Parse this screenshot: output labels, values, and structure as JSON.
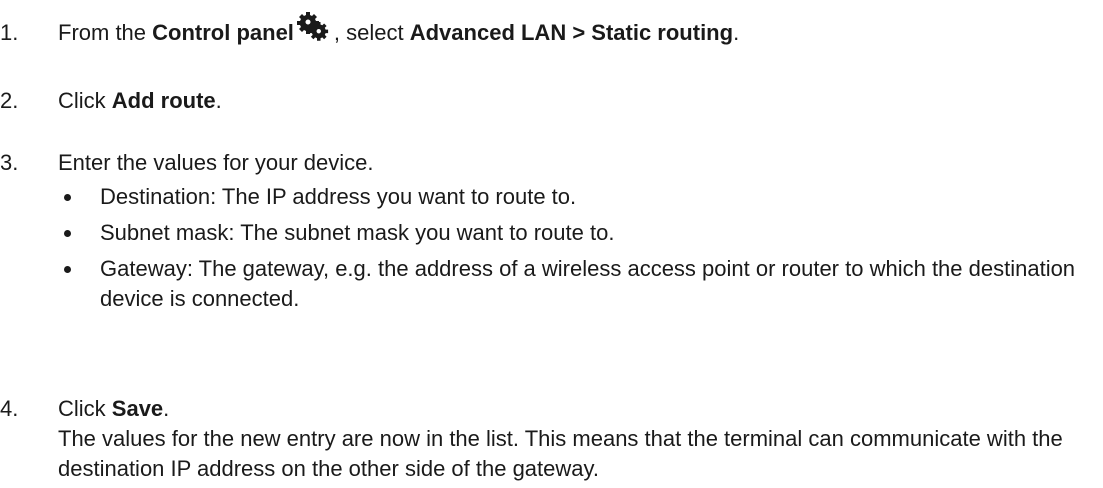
{
  "steps": [
    {
      "number": "1.",
      "parts": [
        "From the ",
        "Control panel",
        ", select ",
        "Advanced LAN > Static routing",
        "."
      ],
      "icon": "gear-icon"
    },
    {
      "number": "2.",
      "parts": [
        "Click ",
        "Add route",
        "."
      ]
    },
    {
      "number": "3.",
      "text": "Enter the values for your device.",
      "bullets": [
        "Destination: The IP address you want to route to.",
        "Subnet mask: The subnet mask you want to route to.",
        "Gateway: The gateway, e.g. the address of a wireless access point or router to which the destination device is connected."
      ]
    },
    {
      "number": "4.",
      "parts": [
        "Click ",
        "Save",
        "."
      ],
      "note": "The values for the new entry are now in the list. This means that the terminal can communicate with the destination IP address on the other side of the gateway."
    }
  ]
}
